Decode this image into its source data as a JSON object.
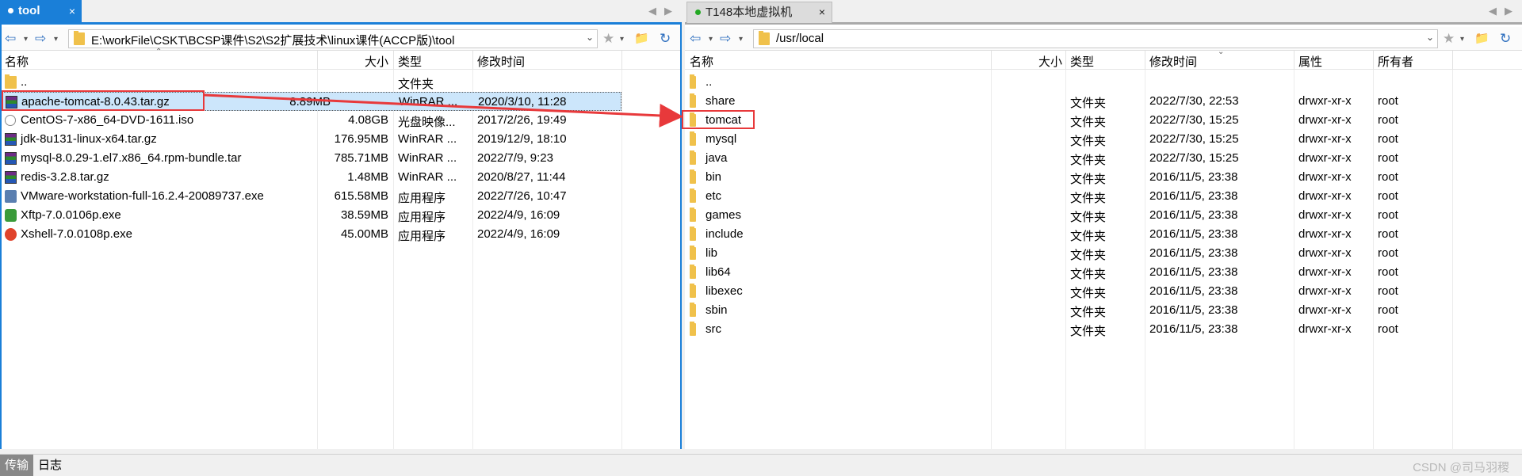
{
  "left": {
    "tab": {
      "label": "tool",
      "close": "×"
    },
    "tabnav": {
      "prev": "◀",
      "next": "▶"
    },
    "toolbar": {
      "back": "⇦",
      "fwd": "⇨",
      "drop": "▾",
      "bookmark": "★",
      "newfolder": "📁",
      "refresh": "↻"
    },
    "path": "E:\\workFile\\CSKT\\BCSP课件\\S2\\S2扩展技术\\linux课件(ACCP版)\\tool",
    "columns": {
      "name": "名称",
      "size": "大小",
      "type": "类型",
      "modified": "修改时间"
    },
    "rows": [
      {
        "name": "..",
        "size": "",
        "type": "文件夹",
        "modified": "",
        "icon": "folder-icon"
      },
      {
        "name": "apache-tomcat-8.0.43.tar.gz",
        "size": "8.89MB",
        "type": "WinRAR ...",
        "modified": "2020/3/10, 11:28",
        "icon": "winrar-icon"
      },
      {
        "name": "CentOS-7-x86_64-DVD-1611.iso",
        "size": "4.08GB",
        "type": "光盘映像...",
        "modified": "2017/2/26, 19:49",
        "icon": "disc-image-icon"
      },
      {
        "name": "jdk-8u131-linux-x64.tar.gz",
        "size": "176.95MB",
        "type": "WinRAR ...",
        "modified": "2019/12/9, 18:10",
        "icon": "winrar-icon"
      },
      {
        "name": "mysql-8.0.29-1.el7.x86_64.rpm-bundle.tar",
        "size": "785.71MB",
        "type": "WinRAR ...",
        "modified": "2022/7/9, 9:23",
        "icon": "winrar-icon"
      },
      {
        "name": "redis-3.2.8.tar.gz",
        "size": "1.48MB",
        "type": "WinRAR ...",
        "modified": "2020/8/27, 11:44",
        "icon": "winrar-icon"
      },
      {
        "name": "VMware-workstation-full-16.2.4-20089737.exe",
        "size": "615.58MB",
        "type": "应用程序",
        "modified": "2022/7/26, 10:47",
        "icon": "vmware-exe-icon"
      },
      {
        "name": "Xftp-7.0.0106p.exe",
        "size": "38.59MB",
        "type": "应用程序",
        "modified": "2022/4/9, 16:09",
        "icon": "xftp-exe-icon"
      },
      {
        "name": "Xshell-7.0.0108p.exe",
        "size": "45.00MB",
        "type": "应用程序",
        "modified": "2022/4/9, 16:09",
        "icon": "xshell-exe-icon"
      }
    ]
  },
  "right": {
    "tab": {
      "label": "T148本地虚拟机",
      "close": "×"
    },
    "tabnav": {
      "prev": "◀",
      "next": "▶"
    },
    "toolbar": {
      "back": "⇦",
      "fwd": "⇨",
      "drop": "▾",
      "bookmark": "★",
      "newfolder": "📁",
      "refresh": "↻"
    },
    "path": "/usr/local",
    "columns": {
      "name": "名称",
      "size": "大小",
      "type": "类型",
      "modified": "修改时间",
      "perm": "属性",
      "owner": "所有者"
    },
    "rows": [
      {
        "name": "..",
        "type": "",
        "modified": "",
        "perm": "",
        "owner": ""
      },
      {
        "name": "share",
        "type": "文件夹",
        "modified": "2022/7/30, 22:53",
        "perm": "drwxr-xr-x",
        "owner": "root"
      },
      {
        "name": "tomcat",
        "type": "文件夹",
        "modified": "2022/7/30, 15:25",
        "perm": "drwxr-xr-x",
        "owner": "root"
      },
      {
        "name": "mysql",
        "type": "文件夹",
        "modified": "2022/7/30, 15:25",
        "perm": "drwxr-xr-x",
        "owner": "root"
      },
      {
        "name": "java",
        "type": "文件夹",
        "modified": "2022/7/30, 15:25",
        "perm": "drwxr-xr-x",
        "owner": "root"
      },
      {
        "name": "bin",
        "type": "文件夹",
        "modified": "2016/11/5, 23:38",
        "perm": "drwxr-xr-x",
        "owner": "root"
      },
      {
        "name": "etc",
        "type": "文件夹",
        "modified": "2016/11/5, 23:38",
        "perm": "drwxr-xr-x",
        "owner": "root"
      },
      {
        "name": "games",
        "type": "文件夹",
        "modified": "2016/11/5, 23:38",
        "perm": "drwxr-xr-x",
        "owner": "root"
      },
      {
        "name": "include",
        "type": "文件夹",
        "modified": "2016/11/5, 23:38",
        "perm": "drwxr-xr-x",
        "owner": "root"
      },
      {
        "name": "lib",
        "type": "文件夹",
        "modified": "2016/11/5, 23:38",
        "perm": "drwxr-xr-x",
        "owner": "root"
      },
      {
        "name": "lib64",
        "type": "文件夹",
        "modified": "2016/11/5, 23:38",
        "perm": "drwxr-xr-x",
        "owner": "root"
      },
      {
        "name": "libexec",
        "type": "文件夹",
        "modified": "2016/11/5, 23:38",
        "perm": "drwxr-xr-x",
        "owner": "root"
      },
      {
        "name": "sbin",
        "type": "文件夹",
        "modified": "2016/11/5, 23:38",
        "perm": "drwxr-xr-x",
        "owner": "root"
      },
      {
        "name": "src",
        "type": "文件夹",
        "modified": "2016/11/5, 23:38",
        "perm": "drwxr-xr-x",
        "owner": "root"
      }
    ]
  },
  "bottom": {
    "transfer": "传输",
    "log": "日志"
  },
  "watermark": "CSDN @司马羽稷",
  "colors": {
    "accent": "#1a7fd8",
    "selection": "#cce6fb",
    "annotation": "#e8393b",
    "folder": "#f0c14b",
    "tab_dot_left": "#ffffff",
    "tab_dot_right": "#22a822"
  }
}
